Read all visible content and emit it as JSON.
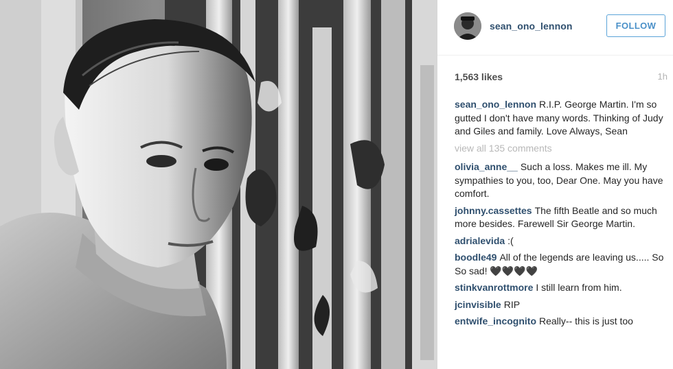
{
  "post": {
    "username": "sean_ono_lennon",
    "follow_label": "FOLLOW",
    "likes": "1,563 likes",
    "time": "1h",
    "caption_user": "sean_ono_lennon",
    "caption_text": "R.I.P. George Martin. I'm so gutted I don't have many words. Thinking of Judy and Giles and family. Love Always, Sean",
    "view_all": "view all 135 comments"
  },
  "comments": [
    {
      "user": "olivia_anne__",
      "text": "Such a loss. Makes me ill. My sympathies to you, too, Dear One. May you have comfort."
    },
    {
      "user": "johnny.cassettes",
      "text": "The fifth Beatle and so much more besides. Farewell Sir George Martin."
    },
    {
      "user": "adrialevida",
      "text": ":("
    },
    {
      "user": "boodle49",
      "text": "All of the legends are leaving us..... So So sad! 🖤🖤🖤🖤"
    },
    {
      "user": "stinkvanrottmore",
      "text": "I still learn from him."
    },
    {
      "user": "jcinvisible",
      "text": "RIP"
    },
    {
      "user": "entwife_incognito",
      "text": "Really-- this is just too"
    }
  ],
  "colors": {
    "username": "#2f4f6e",
    "follow_accent": "#4a90c8",
    "muted": "#b8b8b8"
  }
}
